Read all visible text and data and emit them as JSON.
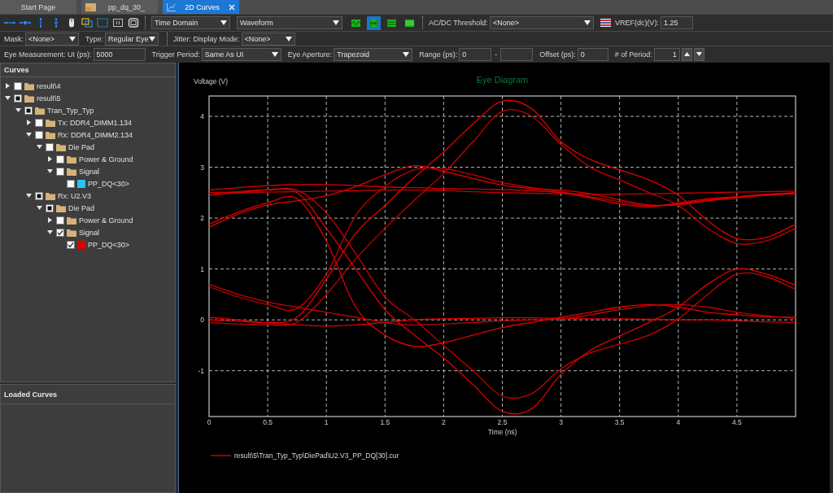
{
  "tabs": [
    {
      "label": "Start Page",
      "kind": "page",
      "selected": false
    },
    {
      "label": "pp_dq_30_",
      "kind": "layout",
      "selected": false
    },
    {
      "label": "2D Curves",
      "kind": "chart",
      "selected": true
    }
  ],
  "toolbar": {
    "selectors": [
      {
        "kind": "dropdown",
        "value": "Time Domain"
      },
      {
        "kind": "dropdown",
        "value": "Waveform"
      }
    ],
    "view_buttons": [
      {
        "kind": "waveform",
        "selected": false
      },
      {
        "kind": "eye",
        "selected": true
      },
      {
        "kind": "bands",
        "selected": false
      },
      {
        "kind": "stripes",
        "selected": false
      }
    ],
    "threshold": {
      "kind": "dropdown",
      "label": "AC/DC Threshold:",
      "value": "<None>"
    },
    "vref": {
      "kind": "input",
      "label": "VREF(dc)(V):",
      "value": "1.25"
    }
  },
  "option_rows": [
    {
      "groups": [
        [
          {
            "kind": "dropdown",
            "label": "Mask:",
            "value": "<None>"
          },
          {
            "kind": "dropdown",
            "label": "Type:",
            "value": "Regular Eye"
          }
        ],
        [
          {
            "kind": "dropdown",
            "label": "Jitter: Display Mode:",
            "value": "<None>"
          }
        ]
      ]
    },
    {
      "groups": [
        [
          {
            "kind": "input",
            "label": "Eye Measurement: UI (ps):",
            "value": "5000"
          },
          {
            "kind": "dropdown",
            "label": "Trigger Period:",
            "value": "Same As UI"
          },
          {
            "kind": "dropdown",
            "label": "Eye Aperture:",
            "value": "Trapezoid"
          },
          {
            "kind": "range",
            "label": "Range (ps):",
            "value": "0",
            "separator": "-"
          },
          {
            "kind": "input",
            "label": "Offset (ps):",
            "value": "0"
          },
          {
            "kind": "spinner",
            "label": "# of Period:",
            "value": "1"
          }
        ]
      ]
    }
  ],
  "curves_panel": {
    "title": "Curves",
    "tree": [
      {
        "label": "result\\4",
        "kind": "folder",
        "expanded": false,
        "checked": false,
        "partial": false
      },
      {
        "label": "result\\5",
        "kind": "folder",
        "expanded": true,
        "checked": false,
        "partial": true,
        "children": [
          {
            "label": "Tran_Typ_Typ",
            "kind": "folder",
            "expanded": true,
            "checked": false,
            "partial": true,
            "children": [
              {
                "label": "Tx: DDR4_DIMM1.134",
                "kind": "folder",
                "expanded": false,
                "checked": false,
                "partial": false
              },
              {
                "label": "Rx: DDR4_DIMM2.134",
                "kind": "folder",
                "expanded": true,
                "checked": false,
                "partial": false,
                "children": [
                  {
                    "label": "Die Pad",
                    "kind": "folder",
                    "expanded": true,
                    "checked": false,
                    "partial": false,
                    "children": [
                      {
                        "label": "Power & Ground",
                        "kind": "folder",
                        "expanded": false,
                        "checked": false,
                        "partial": false
                      },
                      {
                        "label": "Signal",
                        "kind": "folder",
                        "expanded": true,
                        "checked": false,
                        "partial": false,
                        "children": [
                          {
                            "label": "PP_DQ<30>",
                            "kind": "curve",
                            "checked": false,
                            "partial": false,
                            "color": "#29c4f0"
                          }
                        ]
                      }
                    ]
                  }
                ]
              },
              {
                "label": "Rx: U2.V3",
                "kind": "folder",
                "expanded": true,
                "checked": false,
                "partial": true,
                "children": [
                  {
                    "label": "Die Pad",
                    "kind": "folder",
                    "expanded": true,
                    "checked": false,
                    "partial": true,
                    "children": [
                      {
                        "label": "Power & Ground",
                        "kind": "folder",
                        "expanded": false,
                        "checked": false,
                        "partial": false
                      },
                      {
                        "label": "Signal",
                        "kind": "folder",
                        "expanded": true,
                        "checked": true,
                        "partial": false,
                        "children": [
                          {
                            "label": "PP_DQ<30>",
                            "kind": "curve",
                            "checked": true,
                            "partial": false,
                            "color": "#e00000"
                          }
                        ]
                      }
                    ]
                  }
                ]
              }
            ]
          }
        ]
      }
    ]
  },
  "loaded_curves_panel": {
    "title": "Loaded Curves"
  },
  "chart": {
    "chart_data": {
      "type": "line",
      "title": "Eye Diagram",
      "xlabel": "Time (ns)",
      "ylabel": "Voltage (V)",
      "grid": true,
      "x": [
        0,
        0.25,
        0.5,
        0.75,
        1,
        1.25,
        1.5,
        1.75,
        2,
        2.25,
        2.5,
        2.75,
        3,
        3.25,
        3.5,
        3.75,
        4,
        4.25,
        4.5,
        4.75,
        5
      ],
      "xlim": [
        0,
        5
      ],
      "ylim": [
        -1.9,
        4.4
      ],
      "xticks": [
        0,
        0.5,
        1,
        1.5,
        2,
        2.5,
        3,
        3.5,
        4,
        4.5
      ],
      "yticks": [
        -1,
        0,
        1,
        2,
        3,
        4
      ],
      "series": [
        {
          "name": "result\\5\\Tran_Typ_Typ\\DiePad\\U2.V3_PP_DQ[30].cur",
          "color": "#c80000",
          "values": [
            2.5,
            2.5,
            2.51,
            2.52,
            2.53,
            2.54,
            2.55,
            2.55,
            2.54,
            2.52,
            2.5,
            2.49,
            2.48,
            2.47,
            2.47,
            2.48,
            2.49,
            2.5,
            2.51,
            2.52,
            2.53
          ]
        },
        {
          "color": "#e00000",
          "values": [
            2.55,
            2.6,
            2.64,
            2.66,
            2.66,
            2.64,
            2.61,
            2.6,
            2.58,
            2.57,
            2.56,
            2.54,
            2.5,
            2.4,
            2.28,
            2.22,
            2.3,
            2.38,
            2.42,
            2.45,
            2.48
          ]
        },
        {
          "color": "#e00000",
          "values": [
            1.88,
            2.12,
            2.3,
            2.38,
            1.55,
            0.25,
            -0.3,
            -0.52,
            -0.45,
            -0.3,
            -0.15,
            -0.05,
            0.05,
            0.15,
            0.25,
            0.3,
            0.25,
            0.15,
            0.1,
            0.06,
            0.05
          ]
        },
        {
          "color": "#c80000",
          "values": [
            0.65,
            0.45,
            0.3,
            0.22,
            0.9,
            2.05,
            2.62,
            2.95,
            2.97,
            2.85,
            2.7,
            2.6,
            2.52,
            2.42,
            2.32,
            2.24,
            2.28,
            2.36,
            2.42,
            2.47,
            2.5
          ]
        },
        {
          "color": "#e00000",
          "values": [
            1.82,
            2.08,
            2.26,
            2.34,
            2.44,
            2.62,
            2.85,
            3.03,
            2.92,
            2.78,
            2.65,
            2.58,
            2.55,
            2.48,
            2.36,
            2.26,
            2.26,
            2.34,
            2.4,
            2.46,
            2.5
          ]
        },
        {
          "color": "#e00000",
          "values": [
            0.05,
            0.0,
            -0.05,
            0.05,
            0.8,
            1.7,
            2.25,
            2.8,
            3.3,
            3.85,
            4.3,
            4.15,
            3.5,
            3.15,
            2.95,
            2.75,
            2.45,
            1.95,
            1.6,
            1.62,
            1.88
          ]
        },
        {
          "color": "#c80000",
          "values": [
            -0.05,
            -0.08,
            -0.1,
            -0.05,
            0.5,
            1.2,
            1.8,
            2.35,
            2.88,
            3.5,
            4.1,
            4.0,
            3.45,
            3.0,
            2.75,
            2.5,
            2.25,
            1.8,
            1.5,
            1.55,
            1.8
          ]
        },
        {
          "color": "#e00000",
          "values": [
            2.45,
            2.5,
            2.55,
            2.5,
            1.8,
            1.0,
            0.2,
            -0.3,
            -0.75,
            -1.27,
            -1.8,
            -1.75,
            -1.07,
            -0.6,
            -0.32,
            -0.05,
            0.25,
            0.7,
            1.0,
            0.9,
            0.68
          ]
        },
        {
          "color": "#c80000",
          "values": [
            2.5,
            2.52,
            2.56,
            2.55,
            2.1,
            1.3,
            0.45,
            0.0,
            -0.5,
            -1.0,
            -1.5,
            -1.45,
            -0.96,
            -0.65,
            -0.48,
            -0.3,
            0.02,
            0.5,
            0.9,
            0.85,
            0.6
          ]
        },
        {
          "color": "#e00000",
          "values": [
            0.0,
            -0.03,
            -0.06,
            -0.1,
            -0.12,
            -0.1,
            -0.05,
            0.0,
            0.02,
            0.03,
            0.04,
            0.04,
            0.03,
            0.02,
            0.02,
            0.01,
            0.0,
            0.0,
            -0.02,
            -0.04,
            -0.05
          ]
        },
        {
          "color": "#c80000",
          "values": [
            0.7,
            0.5,
            0.35,
            0.25,
            0.15,
            0.05,
            -0.05,
            -0.1,
            -0.08,
            -0.05,
            -0.02,
            0.0,
            0.02,
            0.1,
            0.2,
            0.28,
            0.3,
            0.25,
            0.15,
            0.08,
            0.03
          ]
        }
      ]
    }
  }
}
